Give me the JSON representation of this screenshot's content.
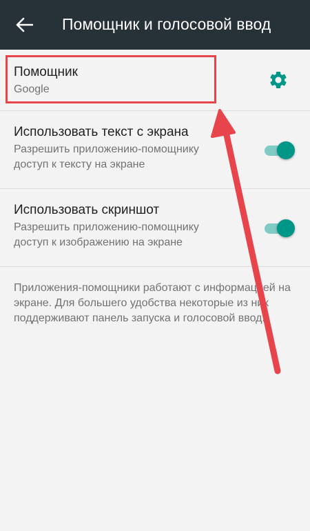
{
  "appbar": {
    "title": "Помощник и голосовой ввод",
    "back_icon": "arrow-back-icon"
  },
  "rows": [
    {
      "title": "Помощник",
      "subtitle": "Google",
      "icon": "gear-icon"
    },
    {
      "title": "Использовать текст с экрана",
      "subtitle": "Разрешить приложению-помощнику доступ к тексту на экране",
      "switch_on": true
    },
    {
      "title": "Использовать скриншот",
      "subtitle": "Разрешить приложению-помощнику доступ к изображению на экране",
      "switch_on": true
    }
  ],
  "footer": "Приложения-помощники работают с информацией на экране. Для большего удобства некоторые из них поддерживают панель запуска и голосовой ввод.",
  "colors": {
    "appbar": "#263238",
    "accent": "#009688",
    "accent_light": "#80cbc4",
    "annotation": "#e8444b"
  }
}
